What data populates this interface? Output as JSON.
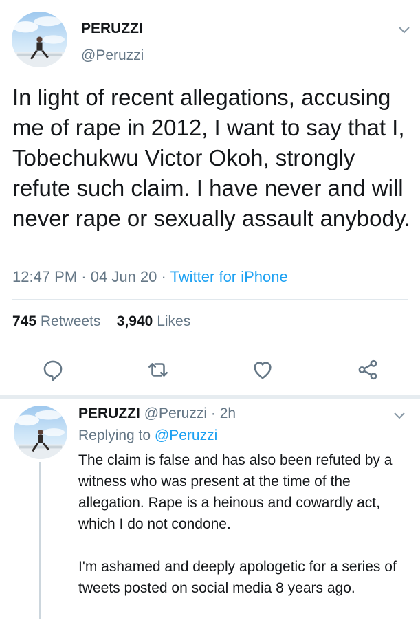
{
  "tweet": {
    "author_name": "PERUZZI",
    "author_handle": "@Peruzzi",
    "text": "In light of recent allegations, accusing me of rape in 2012, I want to say that I, Tobechukwu Victor Okoh, strongly refute such claim. I have never and will never rape or sexually assault anybody.",
    "time": "12:47 PM",
    "date": "04 Jun 20",
    "separator": "·",
    "source": "Twitter for iPhone",
    "retweets_count": "745",
    "retweets_label": "Retweets",
    "likes_count": "3,940",
    "likes_label": "Likes"
  },
  "actions": [
    {
      "icon": "reply-icon"
    },
    {
      "icon": "retweet-icon"
    },
    {
      "icon": "like-icon"
    },
    {
      "icon": "share-icon"
    }
  ],
  "reply": {
    "author_name": "PERUZZI",
    "author_handle": "@Peruzzi",
    "separator": "·",
    "age": "2h",
    "replying_to_label": "Replying to",
    "replying_to_handle": "@Peruzzi",
    "paragraphs": [
      "The claim is false and has also been refuted by a witness who was present at the time of the allegation. Rape is a heinous and cowardly act, which I do not condone.",
      "I'm ashamed and deeply apologetic for a series of tweets posted on social media 8 years ago."
    ]
  },
  "colors": {
    "text": "#14171a",
    "secondary": "#657786",
    "link": "#1da1f2",
    "divider": "#e1e8ed",
    "icon": "#657786"
  }
}
